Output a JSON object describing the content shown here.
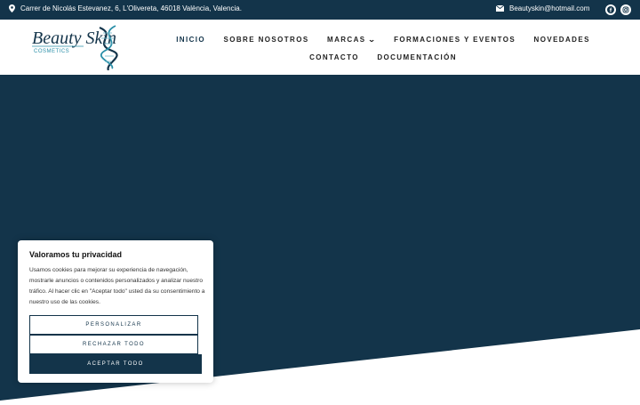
{
  "topbar": {
    "address": "Carrer de Nicolás Estevanez, 6, L'Olivereta, 46018 València, Valencia.",
    "email": "Beautyskin@hotmail.com",
    "location_icon": "map-pin-icon",
    "email_icon": "envelope-icon",
    "social_icons": [
      "facebook-icon",
      "instagram-icon"
    ]
  },
  "logo": {
    "brand": "Beauty Skin",
    "tagline": "COSMETICS"
  },
  "nav": {
    "items": [
      {
        "label": "INICIO",
        "active": true
      },
      {
        "label": "SOBRE NOSOTROS"
      },
      {
        "label": "MARCAS",
        "has_dropdown": true
      },
      {
        "label": "FORMACIONES Y EVENTOS"
      },
      {
        "label": "NOVEDADES"
      },
      {
        "label": "CONTACTO"
      },
      {
        "label": "DOCUMENTACIÓN"
      }
    ]
  },
  "cookie_banner": {
    "title": "Valoramos tu privacidad",
    "body": "Usamos cookies para mejorar su experiencia de navegación, mostrarle anuncios o contenidos personalizados y analizar nuestro tráfico. Al hacer clic en \"Aceptar todo\" usted da su consentimiento a nuestro uso de las cookies.",
    "customize_label": "PERSONALIZAR",
    "reject_label": "RECHAZAR TODO",
    "accept_label": "ACEPTAR TODO"
  },
  "colors": {
    "primary": "#13344a",
    "background": "#ffffff",
    "logo_accent": "#2a8fa8"
  }
}
